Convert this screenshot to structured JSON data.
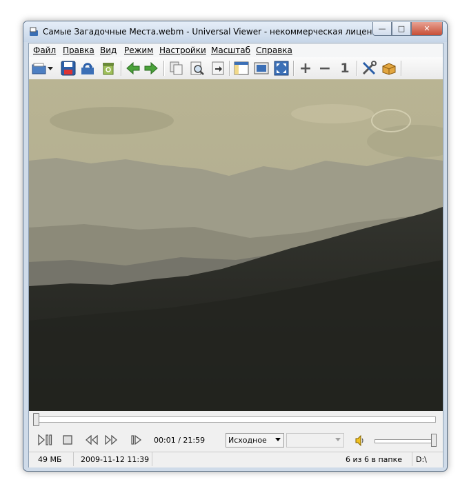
{
  "window": {
    "title": "Самые Загадочные Места.webm - Universal Viewer - некоммерческая лицензия",
    "controls": {
      "minimize": "—",
      "maximize": "□",
      "close": "✕"
    }
  },
  "menu": {
    "items": [
      "Файл",
      "Правка",
      "Вид",
      "Режим",
      "Настройки",
      "Масштаб",
      "Справка"
    ]
  },
  "toolbar": {
    "buttons": [
      {
        "icon": "open-folder-icon"
      },
      {
        "icon": "dropdown-arrow-icon"
      },
      {
        "icon": "save-icon"
      },
      {
        "icon": "rename-icon"
      },
      {
        "icon": "recycle-bin-icon"
      },
      {
        "icon": "arrow-left-icon"
      },
      {
        "icon": "arrow-right-icon"
      },
      {
        "icon": "copy-icon"
      },
      {
        "icon": "find-icon"
      },
      {
        "icon": "export-icon"
      },
      {
        "icon": "panel-icon"
      },
      {
        "icon": "fullscreen-window-icon"
      },
      {
        "icon": "fit-screen-icon"
      },
      {
        "icon": "zoom-in-icon"
      },
      {
        "icon": "zoom-out-icon"
      },
      {
        "icon": "zoom-original-icon"
      },
      {
        "icon": "settings-tools-icon"
      },
      {
        "icon": "plugins-box-icon"
      }
    ],
    "zoom_in": "+",
    "zoom_out": "−",
    "zoom_original": "1"
  },
  "player": {
    "seek_position": 0.0,
    "time": "00:01 / 21:59",
    "aspect_select": "Исходное",
    "second_select": "",
    "volume_level": 1.0
  },
  "status": {
    "size": "49 МБ",
    "date": "2009-11-12 11:39",
    "position": "6 из 6 в папке",
    "path": "D:\\"
  },
  "colors": {
    "sky": "#b3af8e",
    "mountain_far": "#9c9a86",
    "forest": "#2a2b26",
    "close_button": "#c74e36"
  }
}
